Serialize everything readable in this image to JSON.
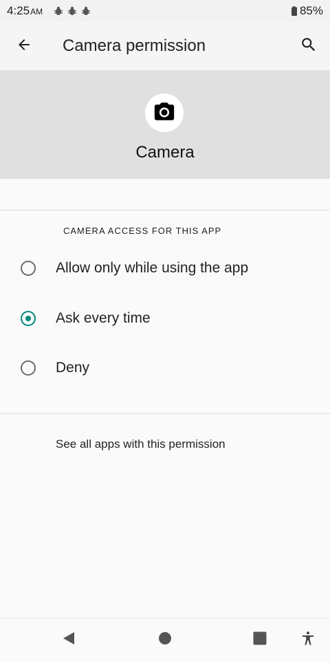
{
  "status_bar": {
    "time": "4:25",
    "ampm": "AM",
    "notification_icons": [
      "bug-icon",
      "bug-icon",
      "bug-icon"
    ],
    "battery_percent": "85%"
  },
  "app_bar": {
    "title": "Camera permission",
    "back_icon": "arrow-back-icon",
    "search_icon": "search-icon"
  },
  "header": {
    "icon": "camera-icon",
    "label": "Camera"
  },
  "section": {
    "heading": "CAMERA ACCESS FOR THIS APP"
  },
  "options": [
    {
      "label": "Allow only while using the app",
      "selected": false
    },
    {
      "label": "Ask every time",
      "selected": true
    },
    {
      "label": "Deny",
      "selected": false
    }
  ],
  "link": {
    "label": "See all apps with this permission"
  },
  "nav": {
    "back_icon": "nav-back-icon",
    "home_icon": "nav-home-icon",
    "recents_icon": "nav-recents-icon",
    "accessibility_icon": "accessibility-icon"
  },
  "colors": {
    "accent": "#00897b",
    "header_band": "#e0e0e0",
    "background": "#fafafa"
  }
}
